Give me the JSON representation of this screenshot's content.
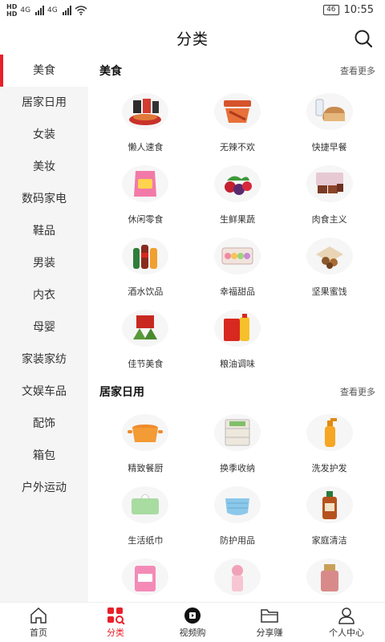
{
  "status_bar": {
    "sim1": "HD",
    "sim2": "HD",
    "net1": "4G",
    "net2": "4G",
    "battery": "46",
    "time": "10:55"
  },
  "header": {
    "title": "分类"
  },
  "sidebar": {
    "items": [
      {
        "label": "美食"
      },
      {
        "label": "居家日用"
      },
      {
        "label": "女装"
      },
      {
        "label": "美妆"
      },
      {
        "label": "数码家电"
      },
      {
        "label": "鞋品"
      },
      {
        "label": "男装"
      },
      {
        "label": "内衣"
      },
      {
        "label": "母婴"
      },
      {
        "label": "家装家纺"
      },
      {
        "label": "文娱车品"
      },
      {
        "label": "配饰"
      },
      {
        "label": "箱包"
      },
      {
        "label": "户外运动"
      }
    ]
  },
  "sections": [
    {
      "title": "美食",
      "more": "查看更多",
      "items": [
        {
          "label": "懒人速食",
          "icon": "instant-noodles-icon"
        },
        {
          "label": "无辣不欢",
          "icon": "spicy-snack-icon"
        },
        {
          "label": "快捷早餐",
          "icon": "bread-milk-icon"
        },
        {
          "label": "休闲零食",
          "icon": "snack-bag-icon"
        },
        {
          "label": "生鲜果蔬",
          "icon": "fruit-icon"
        },
        {
          "label": "肉食主义",
          "icon": "meat-icon"
        },
        {
          "label": "酒水饮品",
          "icon": "bottles-icon"
        },
        {
          "label": "幸福甜品",
          "icon": "macaron-box-icon"
        },
        {
          "label": "坚果蜜饯",
          "icon": "nuts-icon"
        },
        {
          "label": "佳节美食",
          "icon": "zongzi-icon"
        },
        {
          "label": "粮油调味",
          "icon": "rice-oil-icon"
        }
      ]
    },
    {
      "title": "居家日用",
      "more": "查看更多",
      "items": [
        {
          "label": "精致餐厨",
          "icon": "casserole-pot-icon"
        },
        {
          "label": "换季收纳",
          "icon": "storage-drawer-icon"
        },
        {
          "label": "洗发护发",
          "icon": "shampoo-icon"
        },
        {
          "label": "生活纸巾",
          "icon": "tissue-icon"
        },
        {
          "label": "防护用品",
          "icon": "mask-icon"
        },
        {
          "label": "家庭清洁",
          "icon": "disinfectant-icon"
        },
        {
          "label": "",
          "icon": "sanitary-pad-icon"
        },
        {
          "label": "",
          "icon": "kids-cup-icon"
        },
        {
          "label": "",
          "icon": "perfume-icon"
        }
      ]
    }
  ],
  "tabs": [
    {
      "label": "首页",
      "icon": "home-icon"
    },
    {
      "label": "分类",
      "icon": "category-grid-icon"
    },
    {
      "label": "视频购",
      "icon": "video-shop-icon"
    },
    {
      "label": "分享赚",
      "icon": "folder-share-icon"
    },
    {
      "label": "个人中心",
      "icon": "user-icon"
    }
  ],
  "colors": {
    "accent": "#e8202a",
    "sidebar_bg": "#f5f5f5"
  }
}
